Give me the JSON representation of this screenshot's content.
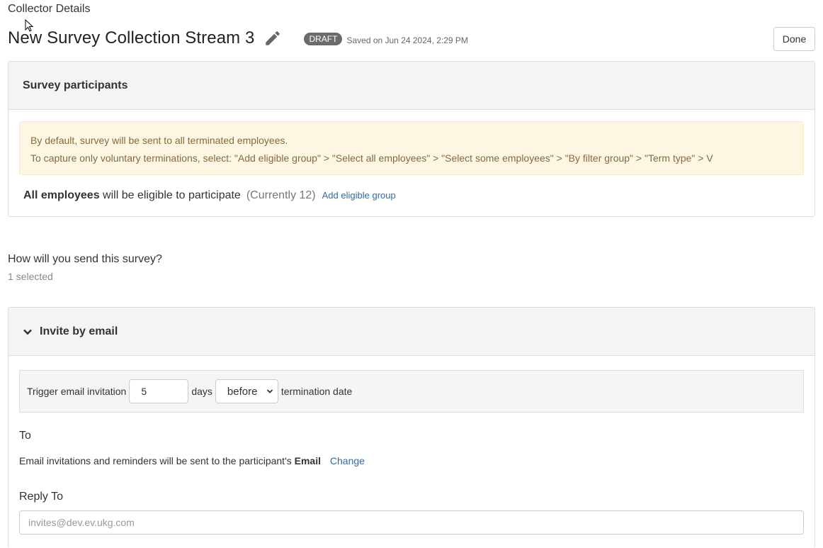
{
  "header": {
    "breadcrumb": "Collector Details",
    "title": "New Survey Collection Stream 3",
    "status_badge": "DRAFT",
    "saved_text": "Saved on Jun 24 2024, 2:29 PM",
    "done_label": "Done",
    "edit_icon": "pencil-icon"
  },
  "participants": {
    "heading": "Survey participants",
    "notice_line1": "By default, survey will be sent to all terminated employees.",
    "notice_line2": "To capture only voluntary terminations, select: \"Add eligible group\" > \"Select all employees\" > \"Select some employees\" > \"By filter group\" > \"Term type\" > V",
    "eligible_bold": "All employees",
    "eligible_text": " will be eligible to participate",
    "eligible_count": "(Currently 12)",
    "add_group_link": "Add eligible group"
  },
  "send": {
    "question": "How will you send this survey?",
    "selected_count": "1 selected"
  },
  "invite_email": {
    "heading": "Invite by email",
    "toggle_icon": "chevron-down-icon",
    "trigger_label": "Trigger email invitation",
    "days_value": "5",
    "days_label": "days",
    "timing_selected": "before",
    "termination_label": "termination date",
    "to_label": "To",
    "to_text": "Email invitations and reminders will be sent to the participant's ",
    "to_bold": "Email",
    "change_link": "Change",
    "reply_to_label": "Reply To",
    "reply_to_placeholder": "invites@dev.ev.ukg.com"
  }
}
